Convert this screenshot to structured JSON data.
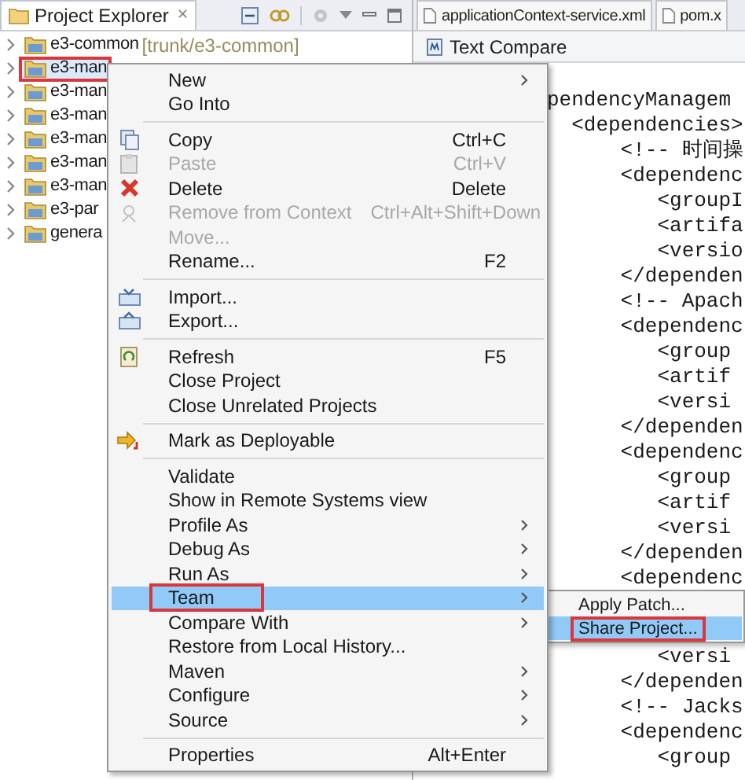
{
  "explorer": {
    "title": "Project Explorer",
    "close": "✕",
    "items": [
      {
        "label": "e3-common",
        "decoration": "[trunk/e3-common]",
        "selected": false,
        "outlined": false
      },
      {
        "label": "e3-man",
        "selected": true,
        "outlined": true
      },
      {
        "label": "e3-man",
        "selected": false,
        "outlined": false
      },
      {
        "label": "e3-man",
        "selected": false,
        "outlined": false
      },
      {
        "label": "e3-man",
        "selected": false,
        "outlined": false
      },
      {
        "label": "e3-man",
        "selected": false,
        "outlined": false
      },
      {
        "label": "e3-man",
        "selected": false,
        "outlined": false
      },
      {
        "label": "e3-par",
        "selected": false,
        "outlined": false
      },
      {
        "label": "genera",
        "selected": false,
        "outlined": false
      }
    ]
  },
  "editor": {
    "tabs": [
      {
        "label": "applicationContext-service.xml"
      },
      {
        "label": "pom.x"
      }
    ],
    "compare_title": "Text Compare",
    "lines": [
      "pendencyManagem",
      "  <dependencies>",
      "      <!-- 时间操",
      "      <dependenc",
      "         <groupI",
      "         <artifa",
      "         <versio",
      "      </dependen",
      "      <!-- Apach",
      "      <dependenc",
      "         <group",
      "         <artif",
      "         <versi",
      "      </dependen",
      "      <dependenc",
      "         <group",
      "         <artif",
      "         <versi",
      "      </dependen",
      "      <dependenc"
    ],
    "lines_below": [
      "         <versi",
      "      </dependen",
      "      <!-- Jacks",
      "      <dependenc",
      "         <group"
    ]
  },
  "menu": {
    "items": [
      {
        "kind": "item",
        "label": "New",
        "submenu": true,
        "disabled": false,
        "selected": false,
        "outlined": false
      },
      {
        "kind": "item",
        "label": "Go Into",
        "submenu": false,
        "disabled": false,
        "selected": false,
        "outlined": false
      },
      {
        "kind": "separator"
      },
      {
        "kind": "item",
        "label": "Copy",
        "shortcut": "Ctrl+C",
        "submenu": false,
        "disabled": false,
        "selected": false,
        "outlined": false
      },
      {
        "kind": "item",
        "label": "Paste",
        "shortcut": "Ctrl+V",
        "submenu": false,
        "disabled": true,
        "selected": false,
        "outlined": false
      },
      {
        "kind": "item",
        "label": "Delete",
        "shortcut": "Delete",
        "submenu": false,
        "disabled": false,
        "selected": false,
        "outlined": false
      },
      {
        "kind": "item",
        "label": "Remove from Context",
        "shortcut": "Ctrl+Alt+Shift+Down",
        "submenu": false,
        "disabled": true,
        "selected": false,
        "outlined": false
      },
      {
        "kind": "item",
        "label": "Move...",
        "submenu": false,
        "disabled": true,
        "selected": false,
        "outlined": false
      },
      {
        "kind": "item",
        "label": "Rename...",
        "shortcut": "F2",
        "submenu": false,
        "disabled": false,
        "selected": false,
        "outlined": false
      },
      {
        "kind": "separator"
      },
      {
        "kind": "item",
        "label": "Import...",
        "submenu": false,
        "disabled": false,
        "selected": false,
        "outlined": false
      },
      {
        "kind": "item",
        "label": "Export...",
        "submenu": false,
        "disabled": false,
        "selected": false,
        "outlined": false
      },
      {
        "kind": "separator"
      },
      {
        "kind": "item",
        "label": "Refresh",
        "shortcut": "F5",
        "submenu": false,
        "disabled": false,
        "selected": false,
        "outlined": false
      },
      {
        "kind": "item",
        "label": "Close Project",
        "submenu": false,
        "disabled": false,
        "selected": false,
        "outlined": false
      },
      {
        "kind": "item",
        "label": "Close Unrelated Projects",
        "submenu": false,
        "disabled": false,
        "selected": false,
        "outlined": false
      },
      {
        "kind": "separator"
      },
      {
        "kind": "item",
        "label": "Mark as Deployable",
        "submenu": false,
        "disabled": false,
        "selected": false,
        "outlined": false
      },
      {
        "kind": "separator"
      },
      {
        "kind": "item",
        "label": "Validate",
        "submenu": false,
        "disabled": false,
        "selected": false,
        "outlined": false
      },
      {
        "kind": "item",
        "label": "Show in Remote Systems view",
        "submenu": false,
        "disabled": false,
        "selected": false,
        "outlined": false
      },
      {
        "kind": "item",
        "label": "Profile As",
        "submenu": true,
        "disabled": false,
        "selected": false,
        "outlined": false
      },
      {
        "kind": "item",
        "label": "Debug As",
        "submenu": true,
        "disabled": false,
        "selected": false,
        "outlined": false
      },
      {
        "kind": "item",
        "label": "Run As",
        "submenu": true,
        "disabled": false,
        "selected": false,
        "outlined": false
      },
      {
        "kind": "item",
        "label": "Team",
        "submenu": true,
        "disabled": false,
        "selected": true,
        "outlined": true
      },
      {
        "kind": "item",
        "label": "Compare With",
        "submenu": true,
        "disabled": false,
        "selected": false,
        "outlined": false
      },
      {
        "kind": "item",
        "label": "Restore from Local History...",
        "submenu": false,
        "disabled": false,
        "selected": false,
        "outlined": false
      },
      {
        "kind": "item",
        "label": "Maven",
        "submenu": true,
        "disabled": false,
        "selected": false,
        "outlined": false
      },
      {
        "kind": "item",
        "label": "Configure",
        "submenu": true,
        "disabled": false,
        "selected": false,
        "outlined": false
      },
      {
        "kind": "item",
        "label": "Source",
        "submenu": true,
        "disabled": false,
        "selected": false,
        "outlined": false
      },
      {
        "kind": "separator"
      },
      {
        "kind": "item",
        "label": "Properties",
        "shortcut": "Alt+Enter",
        "submenu": false,
        "disabled": false,
        "selected": false,
        "outlined": false
      }
    ]
  },
  "submenu": {
    "items": [
      {
        "label": "Apply Patch...",
        "selected": false,
        "outlined": false
      },
      {
        "label": "Share Project...",
        "selected": true,
        "outlined": true
      }
    ]
  }
}
